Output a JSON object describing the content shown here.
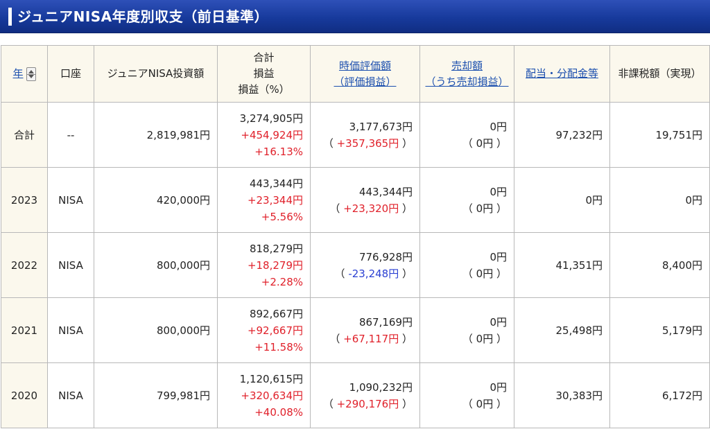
{
  "page_title": "ジュニアNISA年度別収支（前日基準）",
  "colors": {
    "title_bar": "#173a9c",
    "header_bg": "#fbf8ed",
    "positive": "#e0202a",
    "negative": "#2a3fd2",
    "link": "#1b4fae"
  },
  "headers": {
    "year": "年",
    "account": "口座",
    "invested": "ジュニアNISA投資額",
    "total_l1": "合計",
    "total_l2": "損益",
    "total_l3": "損益（%）",
    "market_l1": "時価評価額",
    "market_l2": "（評価損益）",
    "sold_l1": "売却額",
    "sold_l2": "（うち売却損益）",
    "dividend": "配当・分配金等",
    "tax_free": "非課税額（実現）"
  },
  "icons": {
    "sort": "sort-up-down-icon"
  },
  "rows": [
    {
      "year": "合計",
      "account": "--",
      "invested": "2,819,981円",
      "total": "3,274,905円",
      "pl": "+454,924円",
      "pl_pct": "+16.13%",
      "market": "3,177,673円",
      "market_pl": "+357,365円",
      "market_pl_sign": "pos",
      "sold": "0円",
      "sold_pl": "0円",
      "dividend": "97,232円",
      "tax_free": "19,751円"
    },
    {
      "year": "2023",
      "account": "NISA",
      "invested": "420,000円",
      "total": "443,344円",
      "pl": "+23,344円",
      "pl_pct": "+5.56%",
      "market": "443,344円",
      "market_pl": "+23,320円",
      "market_pl_sign": "pos",
      "sold": "0円",
      "sold_pl": "0円",
      "dividend": "0円",
      "tax_free": "0円"
    },
    {
      "year": "2022",
      "account": "NISA",
      "invested": "800,000円",
      "total": "818,279円",
      "pl": "+18,279円",
      "pl_pct": "+2.28%",
      "market": "776,928円",
      "market_pl": "-23,248円",
      "market_pl_sign": "neg",
      "sold": "0円",
      "sold_pl": "0円",
      "dividend": "41,351円",
      "tax_free": "8,400円"
    },
    {
      "year": "2021",
      "account": "NISA",
      "invested": "800,000円",
      "total": "892,667円",
      "pl": "+92,667円",
      "pl_pct": "+11.58%",
      "market": "867,169円",
      "market_pl": "+67,117円",
      "market_pl_sign": "pos",
      "sold": "0円",
      "sold_pl": "0円",
      "dividend": "25,498円",
      "tax_free": "5,179円"
    },
    {
      "year": "2020",
      "account": "NISA",
      "invested": "799,981円",
      "total": "1,120,615円",
      "pl": "+320,634円",
      "pl_pct": "+40.08%",
      "market": "1,090,232円",
      "market_pl": "+290,176円",
      "market_pl_sign": "pos",
      "sold": "0円",
      "sold_pl": "0円",
      "dividend": "30,383円",
      "tax_free": "6,172円"
    }
  ]
}
